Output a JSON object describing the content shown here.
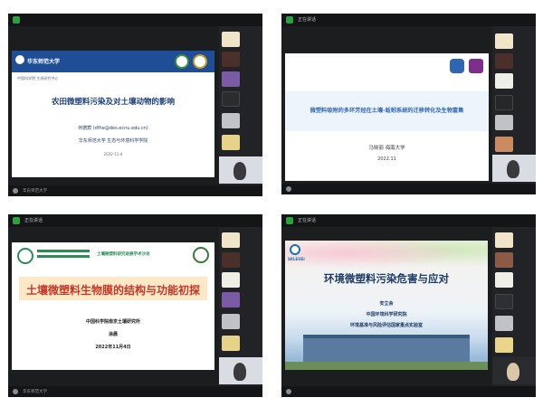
{
  "screens": [
    {
      "topbar": "",
      "bottom_label": "华东师范大学",
      "slide": {
        "header": "华东师范大学",
        "sub_header": "中国科学院 生态研究中心",
        "title": "农田微塑料污染及对土壤动物的影响",
        "author": "何德宸 (dfhe@des.ecnu.edu.cn)",
        "affiliation": "华东师范大学 生态与环境科学学院",
        "date": "2022-11-4"
      }
    },
    {
      "topbar": "正在讲话",
      "bottom_label": "",
      "slide": {
        "title": "微塑料吸附的多环芳烃在土壤-蚯蚓系统的迁移转化及生物富集",
        "author": "马晓丽    海南大学",
        "date": "2022.11"
      }
    },
    {
      "topbar": "正在讲话",
      "bottom_label": "华东师范大学",
      "slide": {
        "header": "土壤微塑料研究进展学术沙龙",
        "title": "土壤微塑料生物膜的结构与功能初探",
        "org": "中国科学院南京土壤研究所",
        "author": "涂晨",
        "date": "2022年11月4日"
      }
    },
    {
      "topbar": "正在讲话",
      "bottom_label": "",
      "slide": {
        "logo_text": "SKLEUEI",
        "title": "环境微塑料污染危害与应对",
        "author": "安立会",
        "org": "中国环境科学研究院",
        "lab": "环境基准与风险评估国家重点实验室"
      }
    }
  ],
  "colors": {
    "frame_bg": "#1c1d1f",
    "slide2_band": "#2f66b3",
    "slide3_title_bg": "#fde9c7",
    "slide3_title_text": "#c0392b",
    "slide4_sky": "#9ec6e7"
  }
}
